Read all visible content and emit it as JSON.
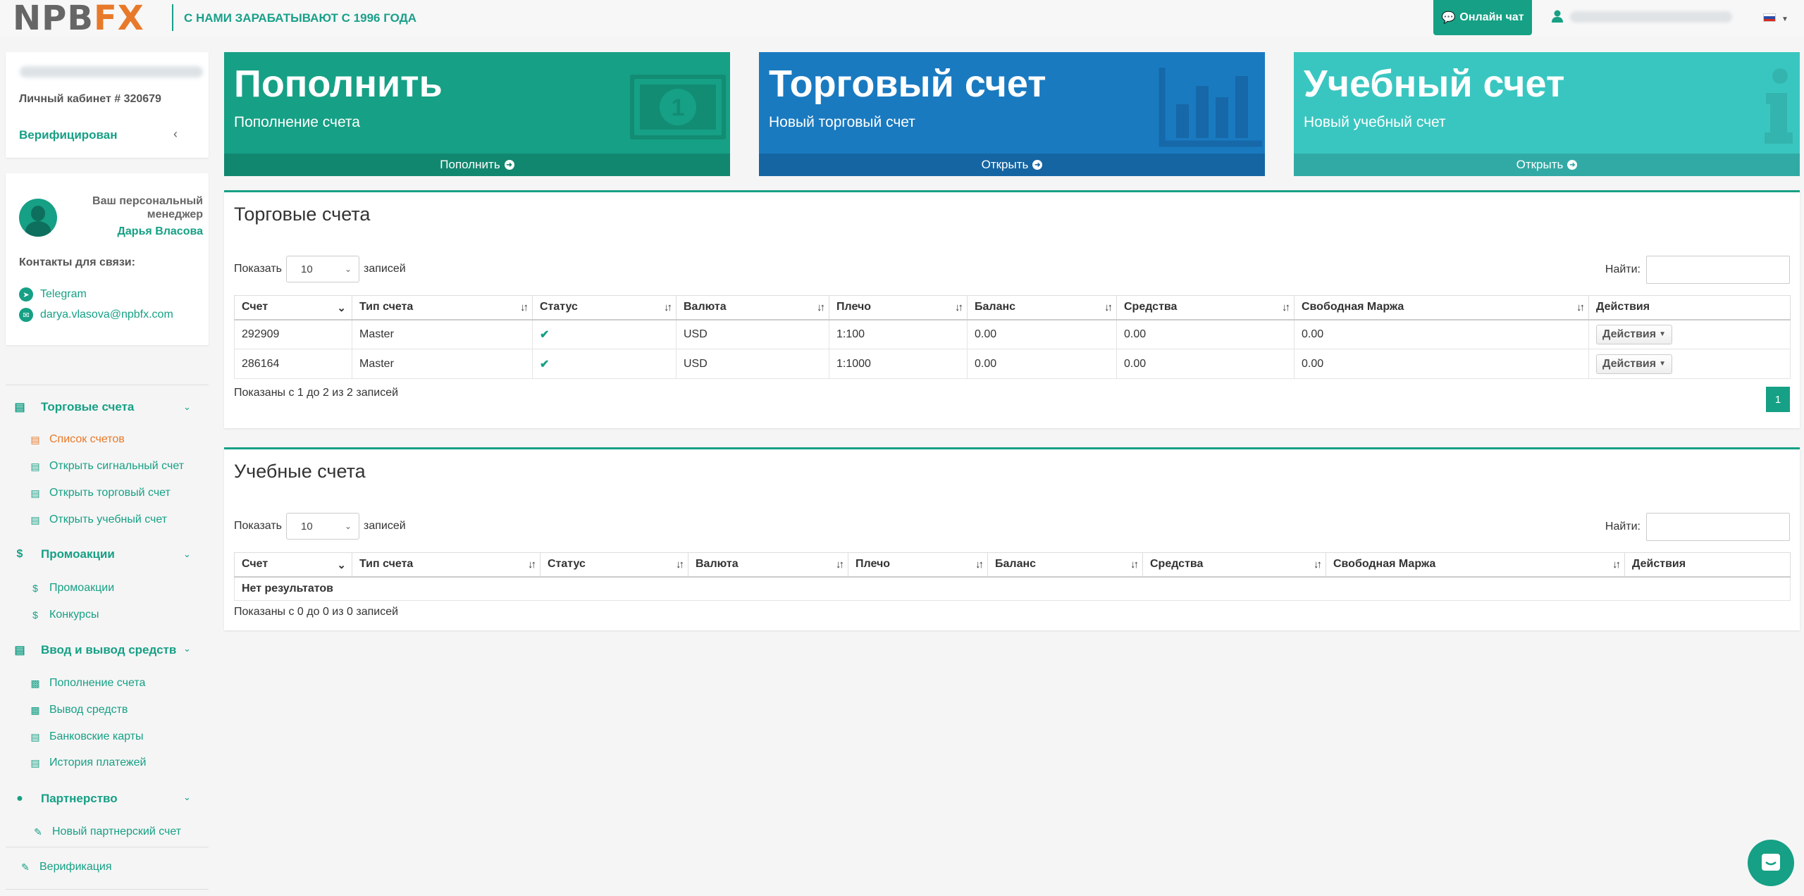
{
  "header": {
    "logo_main": "NPB",
    "logo_fx": "FX",
    "slogan": "С НАМИ ЗАРАБАТЫВАЮТ С 1996 ГОДА",
    "chat_label": "Онлайн чат",
    "flag_colors": [
      "#ffffff",
      "#2c4ea7",
      "#d52b1e"
    ]
  },
  "account": {
    "cabinet_label": "Личный кабинет # 320679",
    "status": "Верифицирован"
  },
  "manager": {
    "title": "Ваш персональный менеджер",
    "name": "Дарья Власова",
    "contacts_label": "Контакты для связи:",
    "telegram": "Telegram",
    "email": "darya.vlasova@npbfx.com"
  },
  "menu": {
    "trading": {
      "label": "Торговые счета",
      "items": [
        "Список счетов",
        "Открыть сигнальный счет",
        "Открыть торговый счет",
        "Открыть учебный счет"
      ]
    },
    "promo": {
      "label": "Промоакции",
      "items": [
        "Промоакции",
        "Конкурсы"
      ]
    },
    "funds": {
      "label": "Ввод и вывод средств",
      "items": [
        "Пополнение счета",
        "Вывод средств",
        "Банковские карты",
        "История платежей"
      ]
    },
    "partner": {
      "label": "Партнерство",
      "items": [
        "Новый партнерский счет"
      ]
    },
    "verification": "Верификация"
  },
  "tiles": [
    {
      "title": "Пополнить",
      "subtitle": "Пополнение счета",
      "footer": "Пополнить"
    },
    {
      "title": "Торговый счет",
      "subtitle": "Новый торговый счет",
      "footer": "Открыть"
    },
    {
      "title": "Учебный счет",
      "subtitle": "Новый учебный счет",
      "footer": "Открыть"
    }
  ],
  "trading_accounts": {
    "title": "Торговые счета",
    "show_label": "Показать",
    "page_size": "10",
    "entries_label": "записей",
    "search_label": "Найти:",
    "columns": [
      "Счет",
      "Тип счета",
      "Статус",
      "Валюта",
      "Плечо",
      "Баланс",
      "Средства",
      "Свободная Маржа",
      "Действия"
    ],
    "rows": [
      {
        "account": "292909",
        "type": "Master",
        "currency": "USD",
        "leverage": "1:100",
        "balance": "0.00",
        "equity": "0.00",
        "free_margin": "0.00",
        "action": "Действия"
      },
      {
        "account": "286164",
        "type": "Master",
        "currency": "USD",
        "leverage": "1:1000",
        "balance": "0.00",
        "equity": "0.00",
        "free_margin": "0.00",
        "action": "Действия"
      }
    ],
    "info": "Показаны с 1 до 2 из 2 записей",
    "page": "1"
  },
  "demo_accounts": {
    "title": "Учебные счета",
    "show_label": "Показать",
    "page_size": "10",
    "entries_label": "записей",
    "search_label": "Найти:",
    "columns": [
      "Счет",
      "Тип счета",
      "Статус",
      "Валюта",
      "Плечо",
      "Баланс",
      "Средства",
      "Свободная Маржа",
      "Действия"
    ],
    "empty": "Нет результатов",
    "info": "Показаны с 0 до 0 из 0 записей"
  }
}
